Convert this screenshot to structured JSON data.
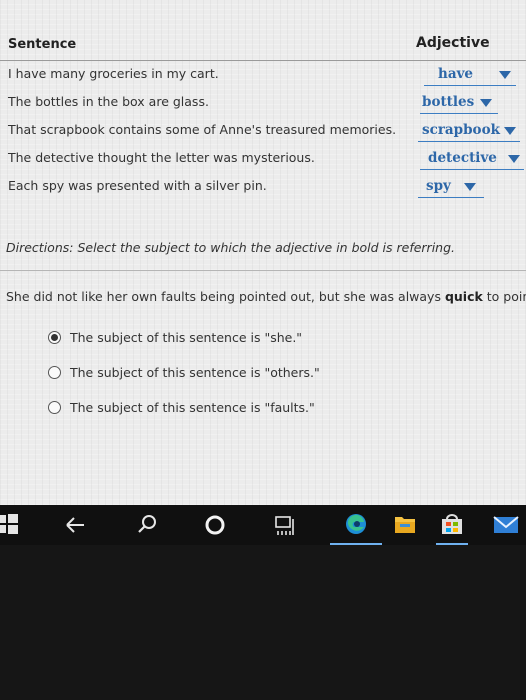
{
  "table": {
    "header_sentence": "Sentence",
    "header_adjective": "Adjective",
    "rows": [
      {
        "sentence": "I have many groceries in my cart.",
        "adjective": "have"
      },
      {
        "sentence": "The bottles in the box are glass.",
        "adjective": "bottles"
      },
      {
        "sentence": "That scrapbook contains some of Anne's treasured memories.",
        "adjective": "scrapbook"
      },
      {
        "sentence": "The detective thought the letter was mysterious.",
        "adjective": "detective"
      },
      {
        "sentence": "Each spy was presented with a silver pin.",
        "adjective": "spy"
      }
    ]
  },
  "directions": "Directions: Select the subject to which the adjective in bold is referring.",
  "question": {
    "before": "She did not like her own faults being pointed out, but she was always ",
    "bold": "quick",
    "after": " to point"
  },
  "options": [
    {
      "label": "The subject of this sentence is \"she.\"",
      "selected": true
    },
    {
      "label": "The subject of this sentence is \"others.\"",
      "selected": false
    },
    {
      "label": "The subject of this sentence is \"faults.\"",
      "selected": false
    }
  ],
  "taskbar": {
    "icons": [
      "windows-start-icon",
      "back-arrow-icon",
      "search-icon",
      "cortana-icon",
      "task-view-icon",
      "edge-browser-icon",
      "file-explorer-icon",
      "store-icon",
      "mail-icon"
    ]
  }
}
